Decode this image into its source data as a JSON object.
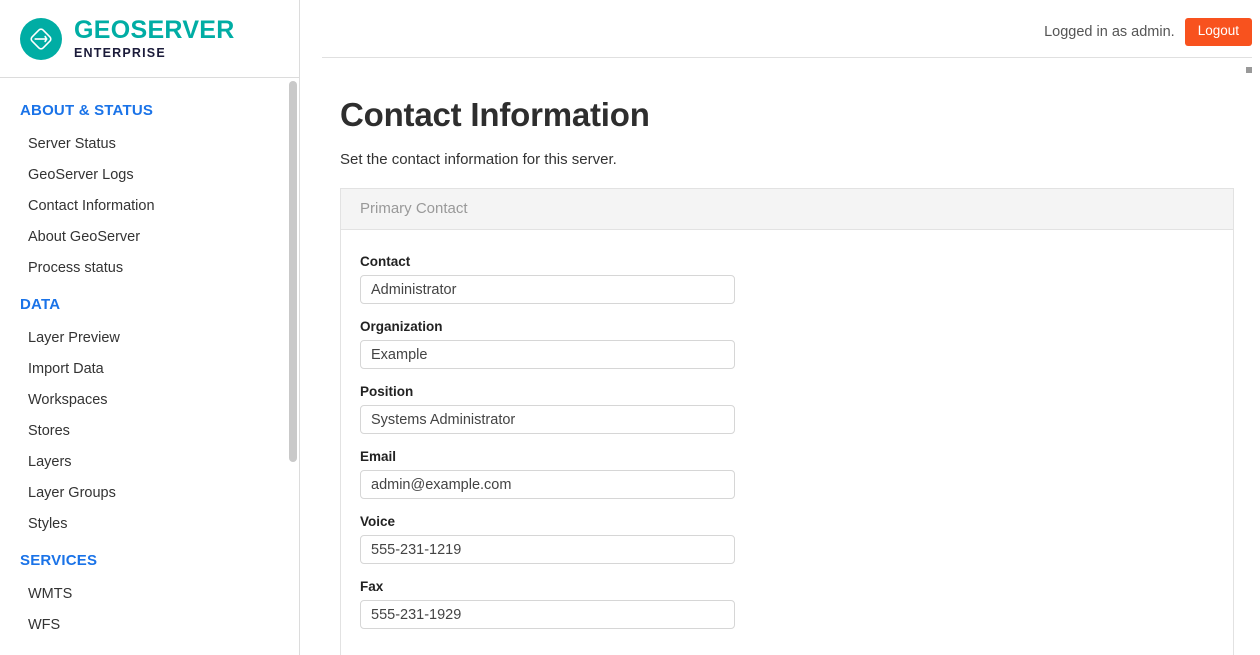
{
  "brand": {
    "title": "GEOSERVER",
    "subtitle": "ENTERPRISE",
    "logo_icon": "geoserver-diamond-icon",
    "accent_color": "#00ada4"
  },
  "topbar": {
    "login_status": "Logged in as admin.",
    "logout_label": "Logout",
    "logout_color": "#f8521e"
  },
  "sidebar": {
    "sections": [
      {
        "label": "ABOUT & STATUS",
        "items": [
          {
            "label": "Server Status"
          },
          {
            "label": "GeoServer Logs"
          },
          {
            "label": "Contact Information"
          },
          {
            "label": "About GeoServer"
          },
          {
            "label": "Process status"
          }
        ]
      },
      {
        "label": "DATA",
        "items": [
          {
            "label": "Layer Preview"
          },
          {
            "label": "Import Data"
          },
          {
            "label": "Workspaces"
          },
          {
            "label": "Stores"
          },
          {
            "label": "Layers"
          },
          {
            "label": "Layer Groups"
          },
          {
            "label": "Styles"
          }
        ]
      },
      {
        "label": "SERVICES",
        "items": [
          {
            "label": "WMTS"
          },
          {
            "label": "WFS"
          }
        ]
      }
    ],
    "header_color": "#1a73e8"
  },
  "main": {
    "title": "Contact Information",
    "subtitle": "Set the contact information for this server.",
    "panel": {
      "legend": "Primary Contact",
      "fields": [
        {
          "label": "Contact",
          "value": "Administrator"
        },
        {
          "label": "Organization",
          "value": "Example"
        },
        {
          "label": "Position",
          "value": "Systems Administrator"
        },
        {
          "label": "Email",
          "value": "admin@example.com"
        },
        {
          "label": "Voice",
          "value": "555-231-1219"
        },
        {
          "label": "Fax",
          "value": "555-231-1929"
        }
      ]
    }
  }
}
